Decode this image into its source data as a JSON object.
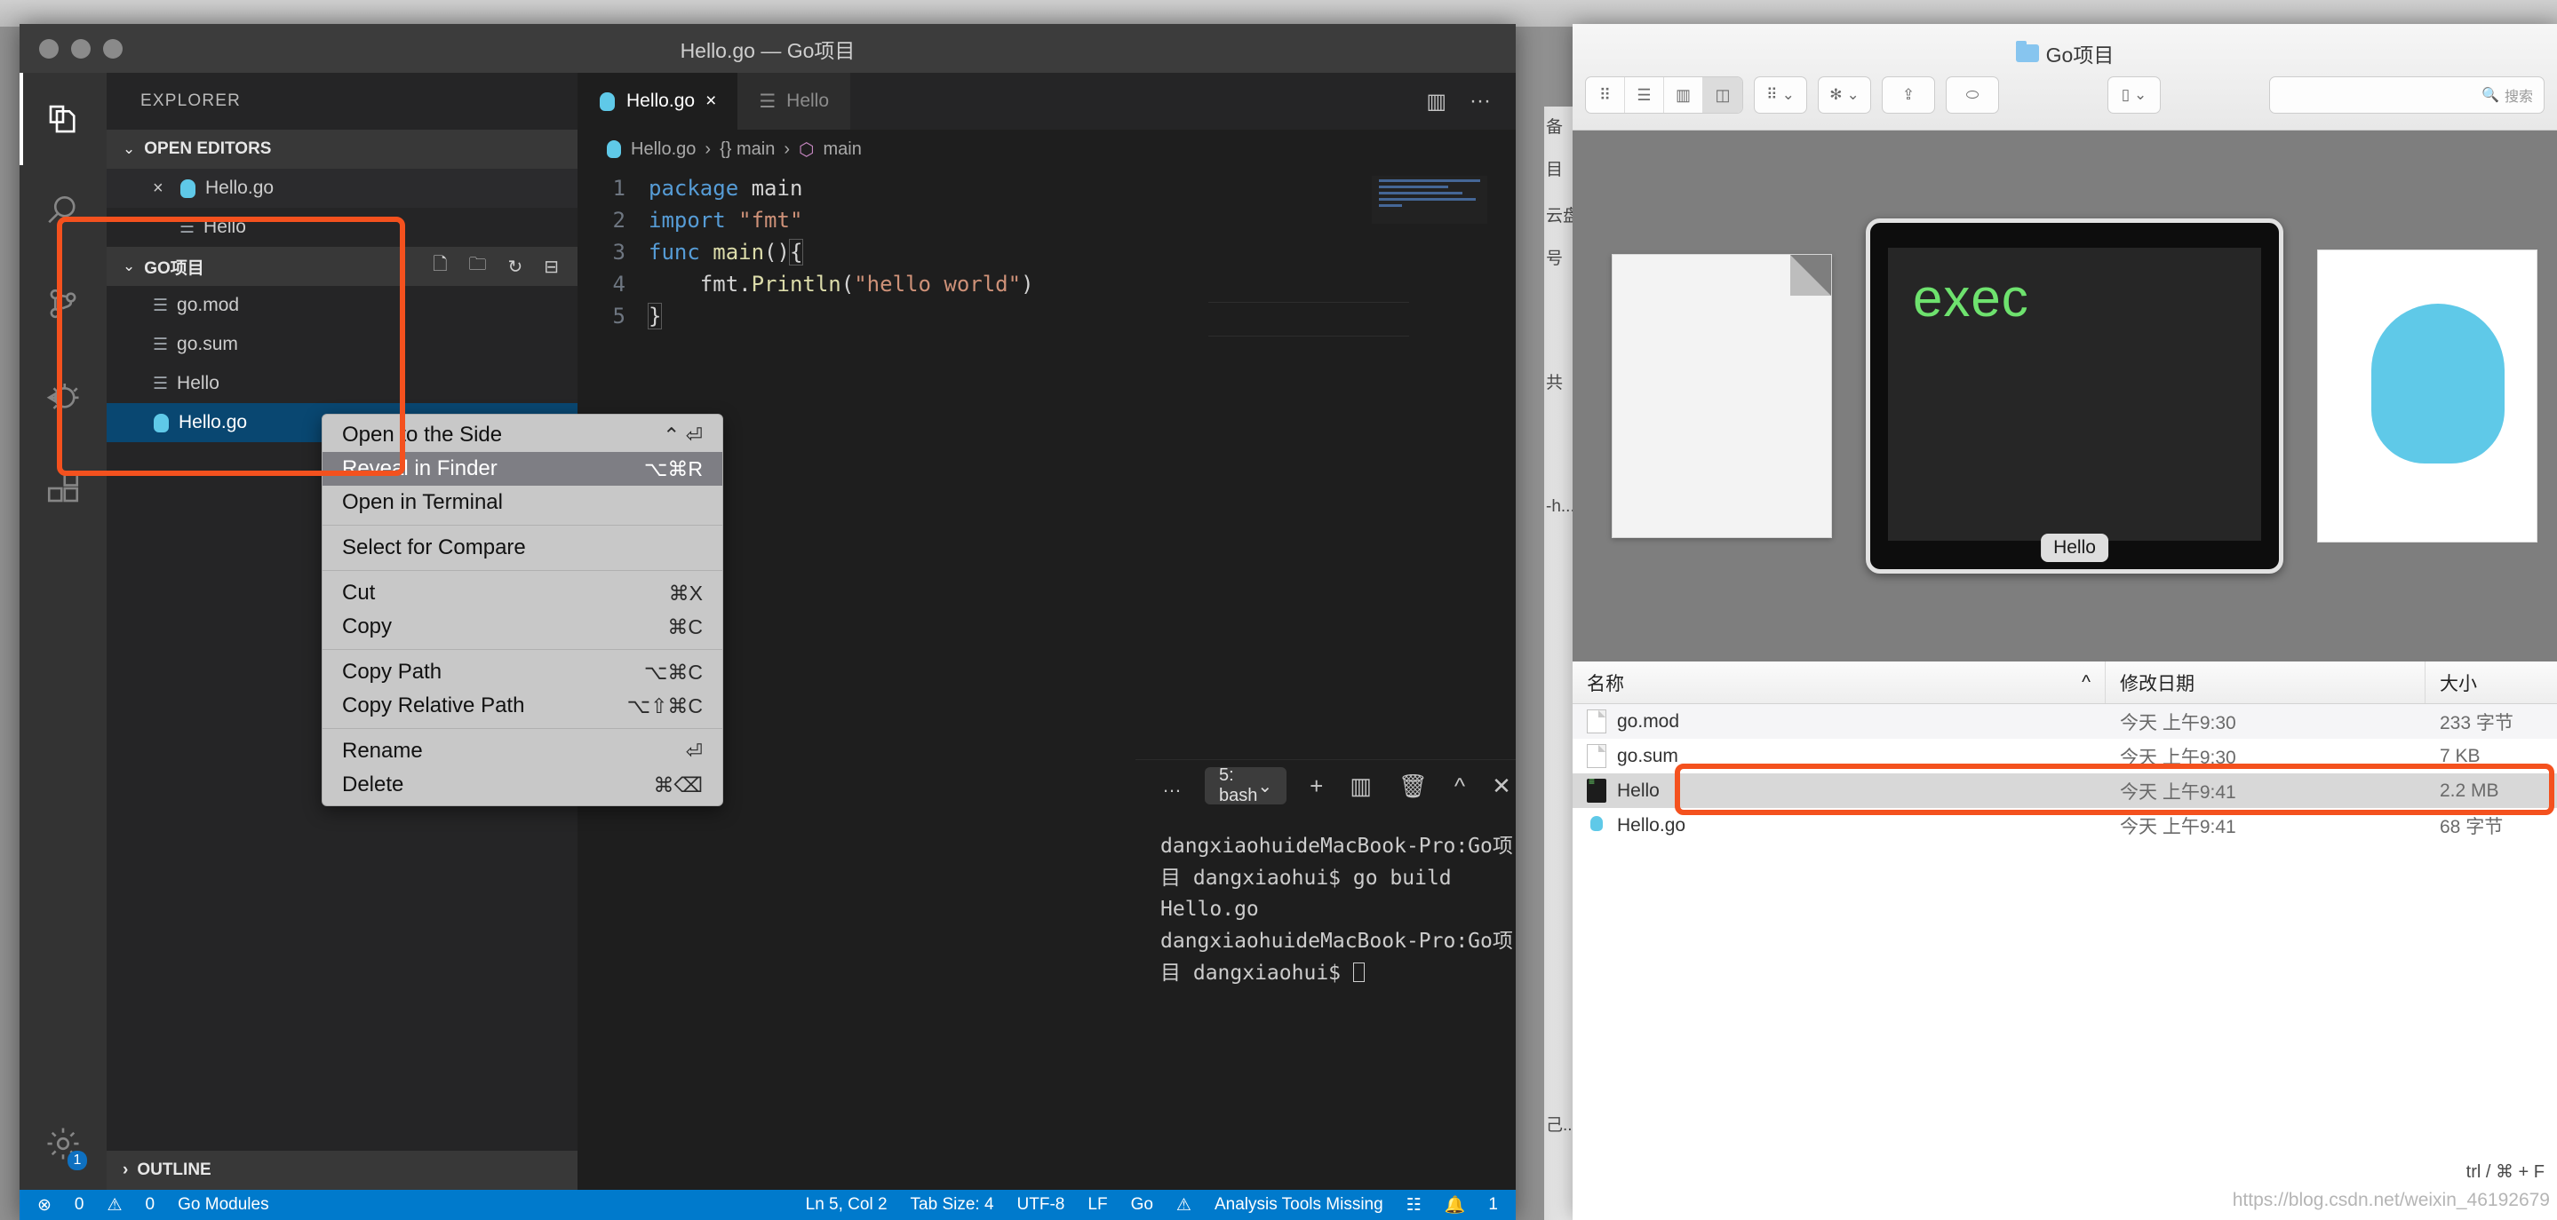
{
  "vscode": {
    "window_title": "Hello.go — Go项目",
    "activitybar": [
      {
        "name": "explorer",
        "icon": "files-icon",
        "active": true
      },
      {
        "name": "search",
        "icon": "search-icon",
        "active": false
      },
      {
        "name": "source-control",
        "icon": "source-control-icon",
        "active": false
      },
      {
        "name": "run-debug",
        "icon": "debug-icon",
        "active": false
      },
      {
        "name": "extensions",
        "icon": "extensions-icon",
        "active": false
      },
      {
        "name": "settings",
        "icon": "gear-icon",
        "active": false
      }
    ],
    "settings_badge": "1",
    "sidebar": {
      "title": "EXPLORER",
      "open_editors": {
        "label": "OPEN EDITORS",
        "items": [
          {
            "label": "Hello.go",
            "icon": "go-file-icon",
            "close": "×",
            "active": true
          },
          {
            "label": "Hello",
            "icon": "text-file-icon",
            "close": "",
            "active": false
          }
        ]
      },
      "project": {
        "label": "GO项目",
        "actions": [
          "new-file-icon",
          "new-folder-icon",
          "refresh-icon",
          "collapse-all-icon"
        ],
        "items": [
          {
            "label": "go.mod",
            "icon": "text-file-icon",
            "selected": false
          },
          {
            "label": "go.sum",
            "icon": "text-file-icon",
            "selected": false
          },
          {
            "label": "Hello",
            "icon": "text-file-icon",
            "selected": false
          },
          {
            "label": "Hello.go",
            "icon": "go-file-icon",
            "selected": true
          }
        ]
      },
      "outline_label": "OUTLINE"
    },
    "tabs": [
      {
        "label": "Hello.go",
        "icon": "go-file-icon",
        "active": true,
        "close": "×"
      },
      {
        "label": "Hello",
        "icon": "text-file-icon",
        "active": false,
        "close": ""
      }
    ],
    "tab_actions": [
      "split-editor-icon",
      "more-actions-icon"
    ],
    "breadcrumb": [
      "Hello.go",
      "{} main",
      "main"
    ],
    "code_lines": [
      {
        "no": "1",
        "tokens": [
          {
            "t": "package ",
            "c": "k"
          },
          {
            "t": "main",
            "c": "p"
          }
        ]
      },
      {
        "no": "2",
        "tokens": [
          {
            "t": "import ",
            "c": "k"
          },
          {
            "t": "\"fmt\"",
            "c": "s"
          }
        ]
      },
      {
        "no": "3",
        "tokens": [
          {
            "t": "func ",
            "c": "k"
          },
          {
            "t": "main",
            "c": "f"
          },
          {
            "t": "()",
            "c": "p"
          },
          {
            "t": "{",
            "c": "brk"
          }
        ]
      },
      {
        "no": "4",
        "tokens": [
          {
            "t": "    fmt",
            "c": "p"
          },
          {
            "t": ".",
            "c": "p"
          },
          {
            "t": "Println",
            "c": "f"
          },
          {
            "t": "(",
            "c": "p"
          },
          {
            "t": "\"hello world\"",
            "c": "s"
          },
          {
            "t": ")",
            "c": "p"
          }
        ]
      },
      {
        "no": "5",
        "tokens": [
          {
            "t": "}",
            "c": "brk"
          }
        ]
      }
    ],
    "panel": {
      "more_icon": "…",
      "terminal_select": "5: bash",
      "chevron": "⌄",
      "icons": [
        "new-terminal-icon",
        "split-terminal-icon",
        "kill-terminal-icon",
        "maximize-panel-icon",
        "close-panel-icon"
      ],
      "lines": [
        "dangxiaohuideMacBook-Pro:Go项目 dangxiaohui$ go build Hello.go",
        "dangxiaohuideMacBook-Pro:Go项目 dangxiaohui$ "
      ]
    },
    "statusbar": {
      "errors_icon": "error-icon",
      "errors": "0",
      "warnings_icon": "warning-icon",
      "warnings": "0",
      "go_modules": "Go Modules",
      "position": "Ln 5, Col 2",
      "tab_size": "Tab Size: 4",
      "encoding": "UTF-8",
      "eol": "LF",
      "language": "Go",
      "analysis": "Analysis Tools Missing",
      "feedback_icon": "feedback-icon",
      "bell": "1"
    }
  },
  "context_menu": {
    "groups": [
      [
        {
          "label": "Open to the Side",
          "accel": "⌃ ⏎",
          "highlight": false
        },
        {
          "label": "Reveal in Finder",
          "accel": "⌥⌘R",
          "highlight": true
        },
        {
          "label": "Open in Terminal",
          "accel": "",
          "highlight": false
        }
      ],
      [
        {
          "label": "Select for Compare",
          "accel": "",
          "highlight": false
        }
      ],
      [
        {
          "label": "Cut",
          "accel": "⌘X",
          "highlight": false
        },
        {
          "label": "Copy",
          "accel": "⌘C",
          "highlight": false
        }
      ],
      [
        {
          "label": "Copy Path",
          "accel": "⌥⌘C",
          "highlight": false
        },
        {
          "label": "Copy Relative Path",
          "accel": "⌥⇧⌘C",
          "highlight": false
        }
      ],
      [
        {
          "label": "Rename",
          "accel": "⏎",
          "highlight": false
        },
        {
          "label": "Delete",
          "accel": "⌘⌫",
          "highlight": false
        }
      ]
    ]
  },
  "finder": {
    "title": "Go项目",
    "view_modes": [
      "icon-view-icon",
      "list-view-icon",
      "column-view-icon",
      "gallery-view-icon"
    ],
    "active_view": 3,
    "toolbar_buttons": [
      "group-by-icon",
      "action-gear-icon",
      "share-icon",
      "tag-icon",
      "dropbox-icon"
    ],
    "search_placeholder": "搜索",
    "preview": {
      "exec_text": "exec",
      "exec_label": "Hello"
    },
    "columns": [
      "名称",
      "修改日期",
      "大小"
    ],
    "sort_indicator": "^",
    "rows": [
      {
        "name": "go.mod",
        "icon": "text-file-icon",
        "date": "今天 上午9:30",
        "size": "233 字节",
        "selected": false
      },
      {
        "name": "go.sum",
        "icon": "text-file-icon",
        "date": "今天 上午9:30",
        "size": "7 KB",
        "selected": false
      },
      {
        "name": "Hello",
        "icon": "unix-exec-icon",
        "date": "今天 上午9:41",
        "size": "2.2 MB",
        "selected": true
      },
      {
        "name": "Hello.go",
        "icon": "go-file-icon",
        "date": "今天 上午9:41",
        "size": "68 字节",
        "selected": false
      }
    ],
    "hint": "trl / ⌘ + F",
    "watermark": "https://blog.csdn.net/weixin_46192679"
  },
  "side_strip": {
    "labels": [
      "备",
      "目",
      "云盘",
      "号",
      "共",
      "-h...",
      "己..."
    ]
  },
  "colors": {
    "accent": "#007acc",
    "selection": "#094771",
    "annotation": "#f4511e",
    "terminal_green": "#6ee26e",
    "go_blue": "#5fc9e8"
  }
}
